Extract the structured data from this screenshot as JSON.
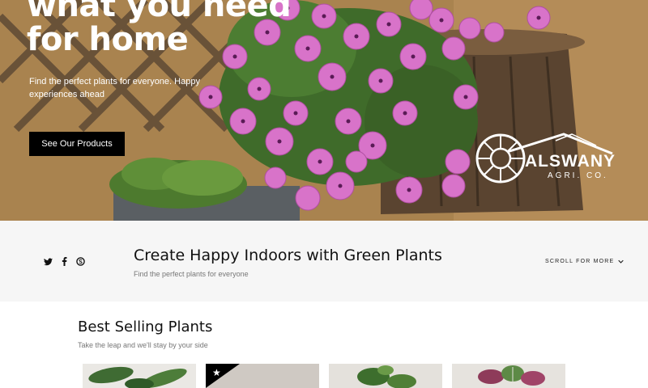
{
  "hero": {
    "title_line1": "what you need",
    "title_line2": "for home",
    "subtitle": "Find the perfect plants for everyone. Happy experiences ahead",
    "cta_label": "See Our Products",
    "logo_name": "ALSWANY",
    "logo_sub": "AGRI. CO."
  },
  "band": {
    "social_icons": [
      "twitter-icon",
      "facebook-icon",
      "skype-icon"
    ],
    "title": "Create Happy Indoors with Green Plants",
    "subtitle": "Find the perfect plants for everyone",
    "scroll_label": "SCROLL FOR MORE"
  },
  "best_selling": {
    "title": "Best Selling Plants",
    "subtitle": "Take the leap and we'll stay by your side",
    "products": [
      {
        "badge": ""
      },
      {
        "badge": "star"
      },
      {
        "badge": ""
      },
      {
        "badge": ""
      }
    ]
  },
  "colors": {
    "button_bg": "#000000",
    "band_bg": "#f6f6f6",
    "flower": "#d96fc9"
  }
}
